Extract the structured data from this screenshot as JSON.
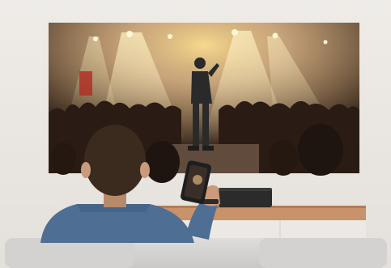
{
  "scene": {
    "subjects": [
      "projected-screen-concert",
      "seated-viewer",
      "smartphone-remote",
      "media-console",
      "projector-device",
      "sofa"
    ],
    "palette": {
      "wall": "#e9e6e2",
      "screen_bg": "#3a2a1f",
      "stage_light": "#f7d98a",
      "performer": "#2a2a2a",
      "shirt": "#4f6e94",
      "hair": "#3b2a1e",
      "skin": "#c99a7c",
      "phone": "#1e1e1e",
      "console_wood": "#c8926a",
      "console_front": "#ece9e4",
      "projector": "#2b2b2b",
      "sofa": "#d7d6d4"
    }
  }
}
